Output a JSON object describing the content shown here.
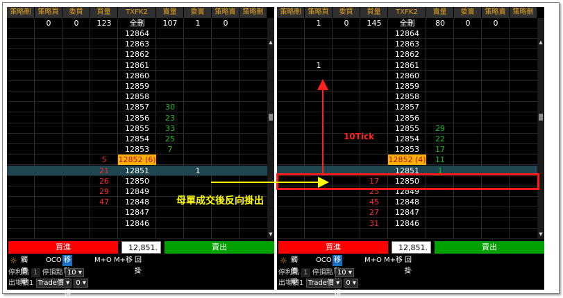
{
  "columns": [
    "策略刪",
    "策略買",
    "委買",
    "買量",
    "TXFK2",
    "賣量",
    "委賣",
    "策略賣",
    "策略刪"
  ],
  "left": {
    "summary": [
      "",
      "0",
      "0",
      "123",
      "全刪",
      "107",
      "1",
      "0",
      ""
    ],
    "rows": [
      {
        "buyq": "",
        "price": "12864",
        "sellq": "",
        "sellord": ""
      },
      {
        "buyq": "",
        "price": "12863",
        "sellq": "",
        "sellord": ""
      },
      {
        "buyq": "",
        "price": "12862",
        "sellq": "",
        "sellord": ""
      },
      {
        "buyq": "",
        "price": "12861",
        "sellq": "",
        "sellord": ""
      },
      {
        "buyq": "",
        "price": "12860",
        "sellq": "",
        "sellord": ""
      },
      {
        "buyq": "",
        "price": "12859",
        "sellq": "",
        "sellord": ""
      },
      {
        "buyq": "",
        "price": "12858",
        "sellq": "",
        "sellord": ""
      },
      {
        "buyq": "",
        "price": "12857",
        "sellq": "30",
        "sellord": ""
      },
      {
        "buyq": "",
        "price": "12856",
        "sellq": "23",
        "sellord": ""
      },
      {
        "buyq": "",
        "price": "12855",
        "sellq": "33",
        "sellord": ""
      },
      {
        "buyq": "",
        "price": "12854",
        "sellq": "25",
        "sellord": ""
      },
      {
        "buyq": "",
        "price": "12853",
        "sellq": "7",
        "sellord": ""
      },
      {
        "buyq": "5",
        "price": "12852 (6)",
        "sellq": "",
        "sellord": "",
        "best": true
      },
      {
        "buyq": "21",
        "price": "12851",
        "sellq": "",
        "sellord": "1",
        "hl": true
      },
      {
        "buyq": "26",
        "price": "12850",
        "sellq": "",
        "sellord": ""
      },
      {
        "buyq": "29",
        "price": "12849",
        "sellq": "",
        "sellord": ""
      },
      {
        "buyq": "47",
        "price": "12848",
        "sellq": "",
        "sellord": ""
      },
      {
        "buyq": "",
        "price": "12847",
        "sellq": "",
        "sellord": ""
      },
      {
        "buyq": "",
        "price": "12846",
        "sellq": "",
        "sellord": ""
      },
      {
        "buyq": "",
        "price": "",
        "sellq": "",
        "sellord": ""
      }
    ]
  },
  "right": {
    "summary": [
      "",
      "1",
      "0",
      "145",
      "全刪",
      "80",
      "0",
      "0",
      ""
    ],
    "rows": [
      {
        "stratbuy": "",
        "buyq": "",
        "price": "12864",
        "sellq": ""
      },
      {
        "stratbuy": "",
        "buyq": "",
        "price": "12863",
        "sellq": ""
      },
      {
        "stratbuy": "",
        "buyq": "",
        "price": "12862",
        "sellq": ""
      },
      {
        "stratbuy": "1",
        "buyq": "",
        "price": "12861",
        "sellq": ""
      },
      {
        "stratbuy": "",
        "buyq": "",
        "price": "12860",
        "sellq": ""
      },
      {
        "stratbuy": "",
        "buyq": "",
        "price": "12859",
        "sellq": ""
      },
      {
        "stratbuy": "",
        "buyq": "",
        "price": "12858",
        "sellq": ""
      },
      {
        "stratbuy": "",
        "buyq": "",
        "price": "12857",
        "sellq": ""
      },
      {
        "stratbuy": "",
        "buyq": "",
        "price": "12856",
        "sellq": ""
      },
      {
        "stratbuy": "",
        "buyq": "",
        "price": "12855",
        "sellq": "29"
      },
      {
        "stratbuy": "",
        "buyq": "",
        "price": "12854",
        "sellq": "22"
      },
      {
        "stratbuy": "",
        "buyq": "",
        "price": "12853",
        "sellq": "17"
      },
      {
        "stratbuy": "",
        "buyq": "",
        "price": "12852 (4)",
        "sellq": "11",
        "best": true
      },
      {
        "stratbuy": "",
        "buyq": "",
        "price": "12851",
        "sellq": "1",
        "hl": true
      },
      {
        "stratbuy": "",
        "buyq": "17",
        "price": "12850",
        "sellq": ""
      },
      {
        "stratbuy": "",
        "buyq": "25",
        "price": "12849",
        "sellq": ""
      },
      {
        "stratbuy": "",
        "buyq": "45",
        "price": "12848",
        "sellq": ""
      },
      {
        "stratbuy": "",
        "buyq": "27",
        "price": "12847",
        "sellq": ""
      },
      {
        "stratbuy": "",
        "buyq": "31",
        "price": "12846",
        "sellq": ""
      },
      {
        "stratbuy": "",
        "buyq": "",
        "price": "",
        "sellq": ""
      }
    ]
  },
  "trade": {
    "buy_label": "買進",
    "sell_label": "賣出",
    "price_value": "12,851."
  },
  "toolbar": {
    "items": [
      "觸價單",
      "OCO",
      "移動停損",
      "M+O",
      "M+移",
      "回掛"
    ],
    "selected": "移動停損"
  },
  "options": {
    "take_profit_label": "停利點",
    "take_profit_value": "1",
    "stop_loss_label": "停損點",
    "stop_loss_value": "10",
    "exit_label": "出場價1",
    "exit_type": "Trade價",
    "exit_offset": "0"
  },
  "annotations": {
    "main_label": "母單成交後反向掛出",
    "tick_label": "10Tick"
  },
  "colors": {
    "accent_header": "#e0a020",
    "buy": "#ff0000",
    "sell": "#00a000",
    "highlight": "#ff1a1a",
    "annot_text": "#ffff00"
  }
}
